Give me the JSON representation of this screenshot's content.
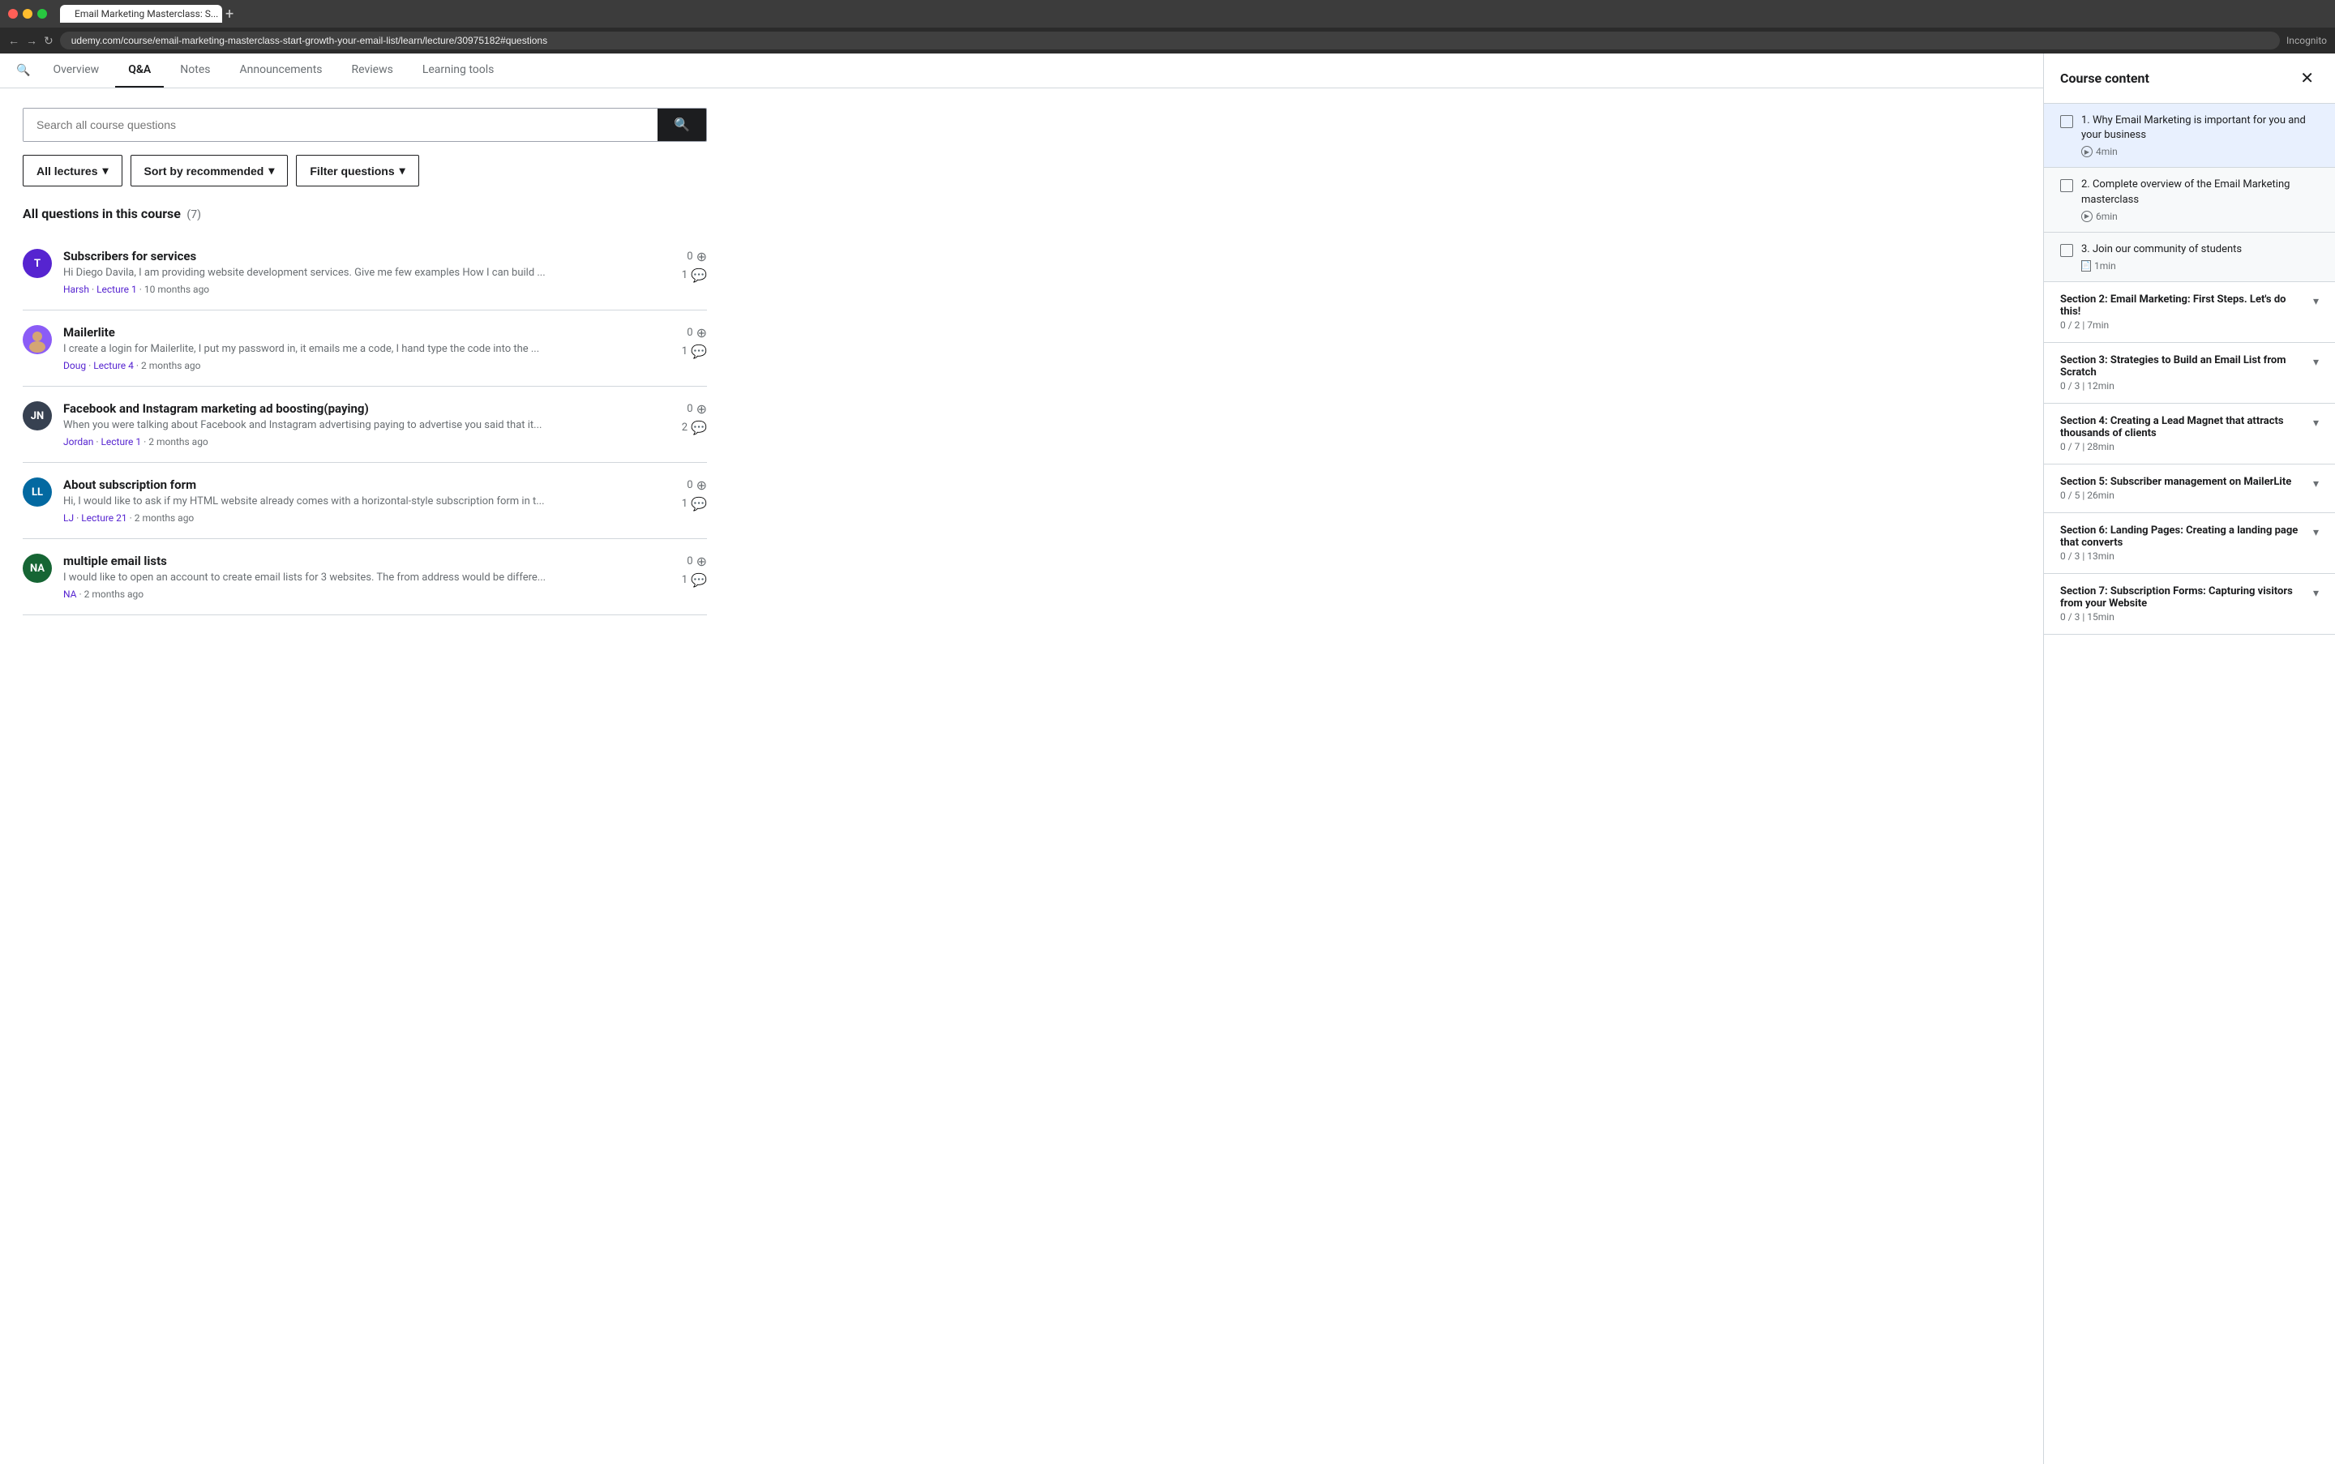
{
  "browser": {
    "url": "udemy.com/course/email-marketing-masterclass-start-growth-your-email-list/learn/lecture/30975182#questions",
    "tab_title": "Email Marketing Masterclass: S...",
    "incognito_label": "Incognito"
  },
  "nav": {
    "tabs": [
      {
        "id": "overview",
        "label": "Overview"
      },
      {
        "id": "qa",
        "label": "Q&A",
        "active": true
      },
      {
        "id": "notes",
        "label": "Notes"
      },
      {
        "id": "announcements",
        "label": "Announcements"
      },
      {
        "id": "reviews",
        "label": "Reviews"
      },
      {
        "id": "learning_tools",
        "label": "Learning tools"
      }
    ]
  },
  "qa": {
    "search_placeholder": "Search all course questions",
    "search_btn_label": "🔍",
    "filters": {
      "lectures": "All lectures",
      "sort": "Sort by recommended",
      "filter": "Filter questions"
    },
    "section_title": "All questions in this course",
    "question_count": "(7)",
    "questions": [
      {
        "id": "q1",
        "avatar_initials": "T",
        "avatar_color": "#5624d0",
        "title": "Subscribers for services",
        "preview": "Hi Diego Davila, I am providing website development services. Give me few examples How I can build ...",
        "author": "Harsh",
        "lecture": "Lecture 1",
        "time_ago": "10 months ago",
        "votes": "0",
        "replies": "1"
      },
      {
        "id": "q2",
        "avatar_initials": "",
        "avatar_color": "#6a6f73",
        "has_photo": true,
        "title": "Mailerlite",
        "preview": "I create a login for Mailerlite, I put my password in, it emails me a code, I hand type the code into the ...",
        "author": "Doug",
        "lecture": "Lecture 4",
        "time_ago": "2 months ago",
        "votes": "0",
        "replies": "1"
      },
      {
        "id": "q3",
        "avatar_initials": "JN",
        "avatar_color": "#1c1d1f",
        "title": "Facebook and Instagram marketing ad boosting(paying)",
        "preview": "When you were talking about Facebook and Instagram advertising paying to advertise you said that it...",
        "author": "Jordan",
        "lecture": "Lecture 1",
        "time_ago": "2 months ago",
        "votes": "0",
        "replies": "2"
      },
      {
        "id": "q4",
        "avatar_initials": "LL",
        "avatar_color": "#0369a1",
        "title": "About subscription form",
        "preview": "Hi, I would like to ask if my HTML website already comes with a horizontal-style subscription form in t...",
        "author": "LJ",
        "lecture": "Lecture 21",
        "time_ago": "2 months ago",
        "votes": "0",
        "replies": "1"
      },
      {
        "id": "q5",
        "avatar_initials": "NA",
        "avatar_color": "#166534",
        "title": "multiple email lists",
        "preview": "I would like to open an account to create email lists for 3 websites. The from address would be differe...",
        "author": "NA",
        "lecture": "Lecture 1",
        "time_ago": "2 months ago",
        "votes": "0",
        "replies": "1"
      }
    ]
  },
  "sidebar": {
    "title": "Course content",
    "close_btn": "✕",
    "lectures": [
      {
        "id": "l1",
        "title": "1. Why Email Marketing is important for you and your business",
        "duration_type": "video",
        "duration": "4min",
        "checked": false,
        "active": true
      },
      {
        "id": "l2",
        "title": "2. Complete overview of the Email Marketing masterclass",
        "duration_type": "video",
        "duration": "6min",
        "checked": false
      },
      {
        "id": "l3",
        "title": "3. Join our community of students",
        "duration_type": "doc",
        "duration": "1min",
        "checked": false
      }
    ],
    "sections": [
      {
        "id": "s2",
        "title": "Section 2: Email Marketing: First Steps. Let's do this!",
        "progress": "0 / 2",
        "duration": "7min"
      },
      {
        "id": "s3",
        "title": "Section 3: Strategies to Build an Email List from Scratch",
        "progress": "0 / 3",
        "duration": "12min"
      },
      {
        "id": "s4",
        "title": "Section 4: Creating a Lead Magnet that attracts thousands of clients",
        "progress": "0 / 7",
        "duration": "28min"
      },
      {
        "id": "s5",
        "title": "Section 5: Subscriber management on MailerLite",
        "progress": "0 / 5",
        "duration": "26min"
      },
      {
        "id": "s6",
        "title": "Section 6: Landing Pages: Creating a landing page that converts",
        "progress": "0 / 3",
        "duration": "13min"
      },
      {
        "id": "s7",
        "title": "Section 7: Subscription Forms: Capturing visitors from your Website",
        "progress": "0 / 3",
        "duration": "15min"
      }
    ]
  }
}
